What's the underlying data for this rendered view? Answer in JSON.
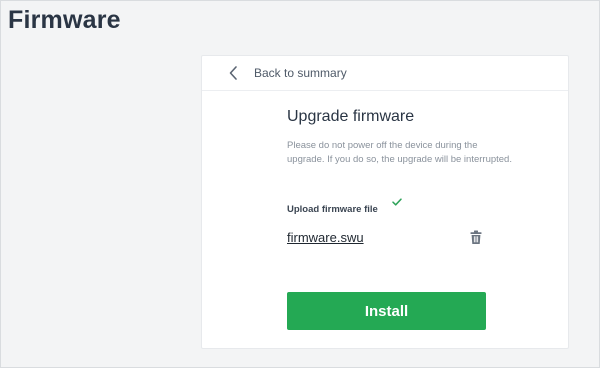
{
  "page": {
    "title": "Firmware"
  },
  "card": {
    "back_label": "Back to summary",
    "heading": "Upgrade firmware",
    "warning": "Please do not power off the device during the upgrade. If you do so, the upgrade will be interrupted.",
    "upload_label": "Upload firmware file",
    "upload_status": "complete",
    "file_name": "firmware.swu",
    "install_label": "Install"
  },
  "icons": {
    "back": "chevron-left-icon",
    "upload_status": "checkmark-icon",
    "delete": "trash-icon"
  },
  "colors": {
    "page_background": "#f3f4f5",
    "title": "#2a3544",
    "accent_green": "#24a954",
    "check_green": "#2fa35a",
    "muted_text": "#8a929c"
  }
}
